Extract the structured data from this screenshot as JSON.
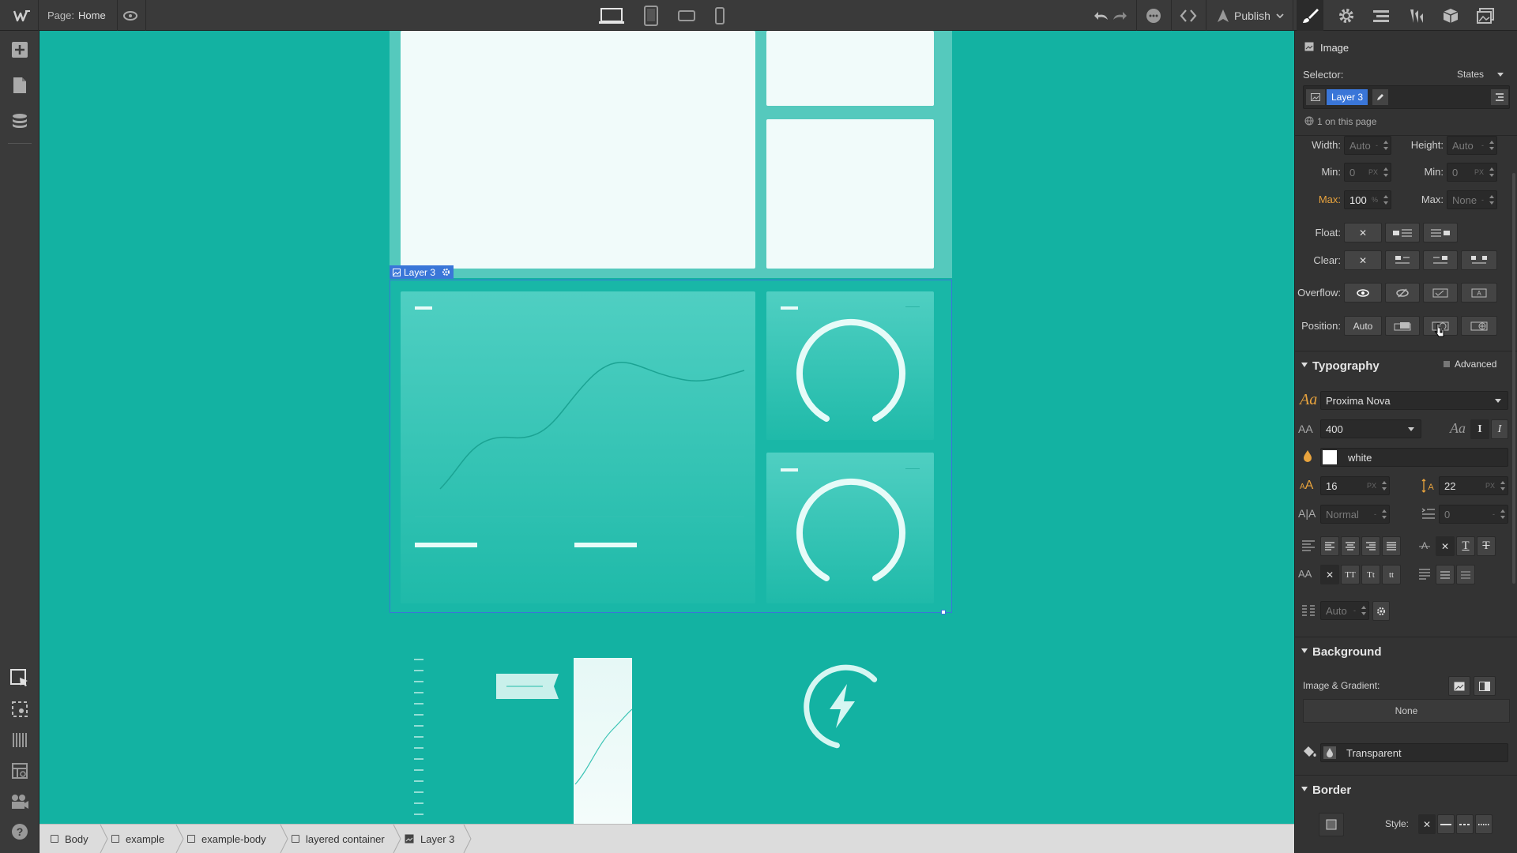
{
  "topbar": {
    "page_label": "Page:",
    "page_name": "Home",
    "publish_label": "Publish"
  },
  "canvas": {
    "selected_label": "Layer 3"
  },
  "breadcrumbs": [
    {
      "label": "Body"
    },
    {
      "label": "example"
    },
    {
      "label": "example-body"
    },
    {
      "label": "layered container"
    },
    {
      "label": "Layer 3"
    }
  ],
  "panel": {
    "element_type": "Image",
    "selector_label": "Selector:",
    "states_label": "States",
    "selector_tag": "Layer 3",
    "on_page": "1 on this page",
    "width_label": "Width:",
    "width_value": "Auto",
    "height_label": "Height:",
    "height_value": "Auto",
    "min_label": "Min:",
    "min_w_value": "0",
    "min_w_unit": "PX",
    "min_h_label": "Min:",
    "min_h_value": "0",
    "min_h_unit": "PX",
    "max_label": "Max:",
    "max_w_value": "100",
    "max_w_unit": "%",
    "max_h_label": "Max:",
    "max_h_value": "None",
    "float_label": "Float:",
    "clear_label": "Clear:",
    "overflow_label": "Overflow:",
    "position_label": "Position:",
    "position_value": "Auto",
    "typography_title": "Typography",
    "advanced_label": "Advanced",
    "font_family": "Proxima Nova",
    "font_weight": "400",
    "color_name": "white",
    "font_size": "16",
    "font_size_unit": "PX",
    "line_height": "22",
    "line_height_unit": "PX",
    "letter_spacing": "Normal",
    "text_indent": "0",
    "columns_value": "Auto",
    "tt_upper": "TT",
    "tt_cap": "Tt",
    "tt_lower": "tt",
    "background_title": "Background",
    "image_gradient_label": "Image & Gradient:",
    "image_none": "None",
    "bg_color_value": "Transparent",
    "border_title": "Border",
    "style_label": "Style:"
  },
  "colors": {
    "canvas_bg": "#13b2a2",
    "selection": "#3a76d8",
    "panel_bg": "#333333",
    "accent_orange": "#e8a33d"
  }
}
